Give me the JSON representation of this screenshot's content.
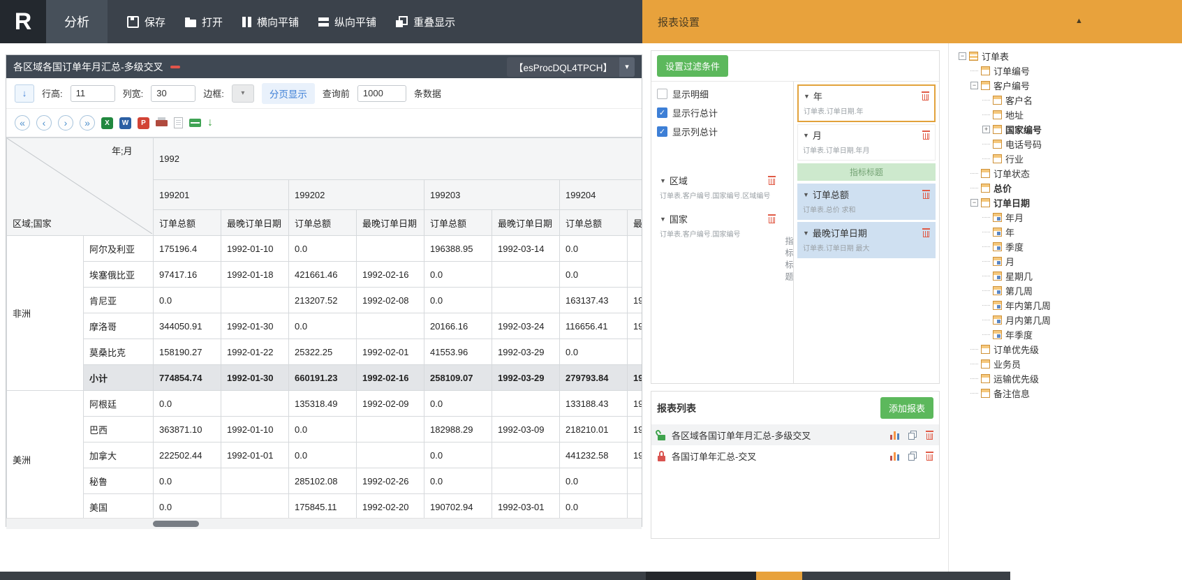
{
  "icons": {
    "brand": "R",
    "collapse_up": "▲",
    "field_caret": "▼",
    "chevron_down": "▾",
    "check": "✓",
    "blue_down_arrow": "↓",
    "green_down_arrow": "↓",
    "nav_first": "«",
    "nav_prev": "‹",
    "nav_next": "›",
    "nav_last": "»",
    "excel": "X",
    "word": "W",
    "pdf": "P",
    "plus": "+",
    "minus": "−"
  },
  "topbar": {
    "tab": "分析",
    "buttons": [
      {
        "label": "保存"
      },
      {
        "label": "打开"
      },
      {
        "label": "横向平铺"
      },
      {
        "label": "纵向平铺"
      },
      {
        "label": "重叠显示"
      }
    ]
  },
  "settings_header": {
    "title": "报表设置"
  },
  "report_window": {
    "title": "各区域各国订单年月汇总-多级交叉",
    "dataset": "【esProcDQL4TPCH】",
    "toolbar": {
      "row_height_label": "行高:",
      "row_height_value": "11",
      "col_width_label": "列宽:",
      "col_width_value": "30",
      "border_label": "边框:",
      "paging_label": "分页显示",
      "query_prefix": "查询前",
      "query_value": "1000",
      "query_suffix": "条数据"
    }
  },
  "pivot": {
    "corner_top": "年;月",
    "corner_bottom": "区域;国家",
    "year": "1992",
    "months": [
      "199201",
      "199202",
      "199203",
      "199204"
    ],
    "measures": [
      "订单总额",
      "最晚订单日期"
    ],
    "groups": [
      {
        "region": "非洲",
        "rows": [
          {
            "country": "阿尔及利亚",
            "cells": [
              "175196.4",
              "1992-01-10",
              "0.0",
              "",
              "196388.95",
              "1992-03-14",
              "0.0",
              ""
            ]
          },
          {
            "country": "埃塞俄比亚",
            "cells": [
              "97417.16",
              "1992-01-18",
              "421661.46",
              "1992-02-16",
              "0.0",
              "",
              "0.0",
              ""
            ]
          },
          {
            "country": "肯尼亚",
            "cells": [
              "0.0",
              "",
              "213207.52",
              "1992-02-08",
              "0.0",
              "",
              "163137.43",
              "19"
            ]
          },
          {
            "country": "摩洛哥",
            "cells": [
              "344050.91",
              "1992-01-30",
              "0.0",
              "",
              "20166.16",
              "1992-03-24",
              "116656.41",
              "19"
            ]
          },
          {
            "country": "莫桑比克",
            "cells": [
              "158190.27",
              "1992-01-22",
              "25322.25",
              "1992-02-01",
              "41553.96",
              "1992-03-29",
              "0.0",
              ""
            ]
          }
        ],
        "subtotal": {
          "label": "小计",
          "cells": [
            "774854.74",
            "1992-01-30",
            "660191.23",
            "1992-02-16",
            "258109.07",
            "1992-03-29",
            "279793.84",
            "19"
          ]
        }
      },
      {
        "region": "美洲",
        "rows": [
          {
            "country": "阿根廷",
            "cells": [
              "0.0",
              "",
              "135318.49",
              "1992-02-09",
              "0.0",
              "",
              "133188.43",
              "19"
            ]
          },
          {
            "country": "巴西",
            "cells": [
              "363871.10",
              "1992-01-10",
              "0.0",
              "",
              "182988.29",
              "1992-03-09",
              "218210.01",
              "19"
            ]
          },
          {
            "country": "加拿大",
            "cells": [
              "222502.44",
              "1992-01-01",
              "0.0",
              "",
              "0.0",
              "",
              "441232.58",
              "19"
            ]
          },
          {
            "country": "秘鲁",
            "cells": [
              "0.0",
              "",
              "285102.08",
              "1992-02-26",
              "0.0",
              "",
              "0.0",
              ""
            ]
          },
          {
            "country": "美国",
            "cells": [
              "0.0",
              "",
              "175845.11",
              "1992-02-20",
              "190702.94",
              "1992-03-01",
              "0.0",
              ""
            ]
          }
        ]
      }
    ]
  },
  "settings_panel": {
    "filter_button": "设置过滤条件",
    "checkboxes": [
      {
        "label": "显示明细",
        "checked": false
      },
      {
        "label": "显示行总计",
        "checked": true
      },
      {
        "label": "显示列总计",
        "checked": true
      }
    ],
    "row_fields": [
      {
        "name": "区域",
        "path": "订单表.客户编号.国家编号.区域编号"
      },
      {
        "name": "国家",
        "path": "订单表.客户编号.国家编号"
      }
    ],
    "col_fields": [
      {
        "name": "年",
        "path": "订单表.订单日期.年"
      },
      {
        "name": "月",
        "path": "订单表.订单日期.年月"
      }
    ],
    "measure_title_bar": "指标标题",
    "vertical_label": "指标标题",
    "measures": [
      {
        "name": "订单总额",
        "path": "订单表.总价 求和"
      },
      {
        "name": "最晚订单日期",
        "path": "订单表.订单日期 最大"
      }
    ]
  },
  "report_list": {
    "title": "报表列表",
    "add_button": "添加报表",
    "items": [
      {
        "name": "各区域各国订单年月汇总-多级交叉"
      },
      {
        "name": "各国订单年汇总-交叉"
      }
    ]
  },
  "field_tree": {
    "items": [
      {
        "label": "订单表"
      },
      {
        "label": "订单编号"
      },
      {
        "label": "客户编号"
      },
      {
        "label": "客户名"
      },
      {
        "label": "地址"
      },
      {
        "label": "国家编号"
      },
      {
        "label": "电话号码"
      },
      {
        "label": "行业"
      },
      {
        "label": "订单状态"
      },
      {
        "label": "总价"
      },
      {
        "label": "订单日期"
      },
      {
        "label": "年月"
      },
      {
        "label": "年"
      },
      {
        "label": "季度"
      },
      {
        "label": "月"
      },
      {
        "label": "星期几"
      },
      {
        "label": "第几周"
      },
      {
        "label": "年内第几周"
      },
      {
        "label": "月内第几周"
      },
      {
        "label": "年季度"
      },
      {
        "label": "订单优先级"
      },
      {
        "label": "业务员"
      },
      {
        "label": "运输优先级"
      },
      {
        "label": "备注信息"
      }
    ]
  }
}
